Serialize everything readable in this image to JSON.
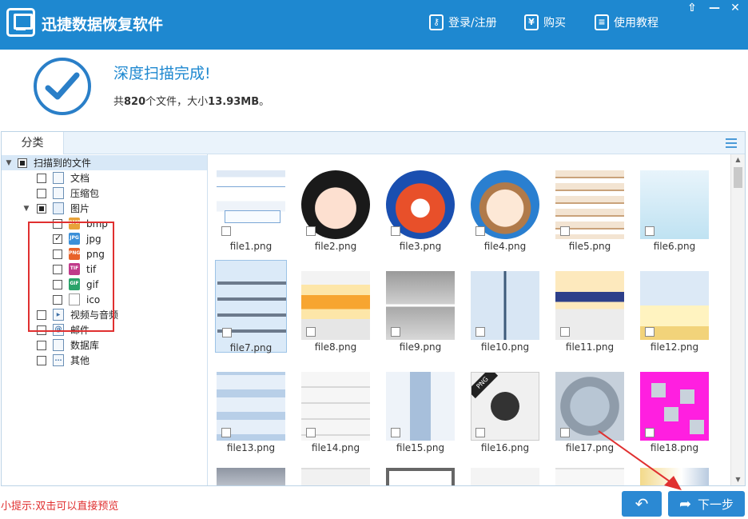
{
  "app": {
    "title": "迅捷数据恢复软件",
    "login_label": "登录/注册",
    "buy_label": "购买",
    "buy_icon_glyph": "¥",
    "tutorial_label": "使用教程",
    "window_controls": [
      "⇧",
      "—",
      "☐",
      "✕"
    ]
  },
  "status": {
    "title": "深度扫描完成!",
    "summary_prefix": "共",
    "file_count": "820",
    "summary_mid": "个文件，大小",
    "total_size": "13.93MB",
    "summary_suffix": "。"
  },
  "panel": {
    "category_tab": "分类"
  },
  "tree": {
    "root": "扫描到的文件",
    "items": [
      {
        "label": "文档",
        "icon": "document-icon"
      },
      {
        "label": "压缩包",
        "icon": "archive-icon"
      },
      {
        "label": "图片",
        "icon": "image-icon"
      },
      {
        "label": "bmp",
        "icon": "bmp-icon",
        "tag": "BMP"
      },
      {
        "label": "jpg",
        "icon": "jpg-icon",
        "tag": "JPG",
        "checked": true
      },
      {
        "label": "png",
        "icon": "png-icon",
        "tag": "PNG"
      },
      {
        "label": "tif",
        "icon": "tif-icon",
        "tag": "TIF"
      },
      {
        "label": "gif",
        "icon": "gif-icon",
        "tag": "GIF"
      },
      {
        "label": "ico",
        "icon": "ico-icon"
      },
      {
        "label": "视频与音频",
        "icon": "video-icon"
      },
      {
        "label": "邮件",
        "icon": "mail-icon",
        "glyph": "@"
      },
      {
        "label": "数据库",
        "icon": "database-icon"
      },
      {
        "label": "其他",
        "icon": "other-icon",
        "glyph": "···"
      }
    ]
  },
  "files": [
    "file1.png",
    "file2.png",
    "file3.png",
    "file4.png",
    "file5.png",
    "file6.png",
    "file7.png",
    "file8.png",
    "file9.png",
    "file10.png",
    "file11.png",
    "file12.png",
    "file13.png",
    "file14.png",
    "file15.png",
    "file16.png",
    "file17.png",
    "file18.png"
  ],
  "thumb_badge": "PNG",
  "footer": {
    "hint": "小提示:双击可以直接预览",
    "back_label": "↶",
    "next_label": "下一步"
  },
  "colors": {
    "brand": "#1e88d0",
    "highlight": "#e03030",
    "button": "#2b89d3"
  }
}
